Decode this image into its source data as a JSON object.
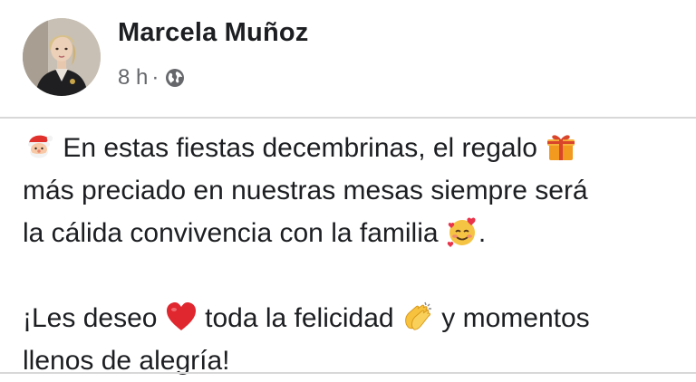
{
  "post": {
    "author": {
      "name": "Marcela Muñoz"
    },
    "timestamp": "8 h",
    "separator": "·",
    "privacy_icon": "globe-icon",
    "body": {
      "line1": "En estas fiestas decembrinas, el regalo",
      "line2": "más preciado en nuestras mesas siempre será",
      "line3": "la cálida convivencia con la familia",
      "line3_end": ".",
      "line4_a": "¡Les deseo",
      "line4_b": "toda la felicidad",
      "line4_c": "y momentos",
      "line5": "llenos de alegría!"
    },
    "emojis": [
      "santa-emoji",
      "gift-emoji",
      "smiling-face-with-hearts-emoji",
      "red-heart-emoji",
      "clapping-hands-emoji"
    ]
  }
}
